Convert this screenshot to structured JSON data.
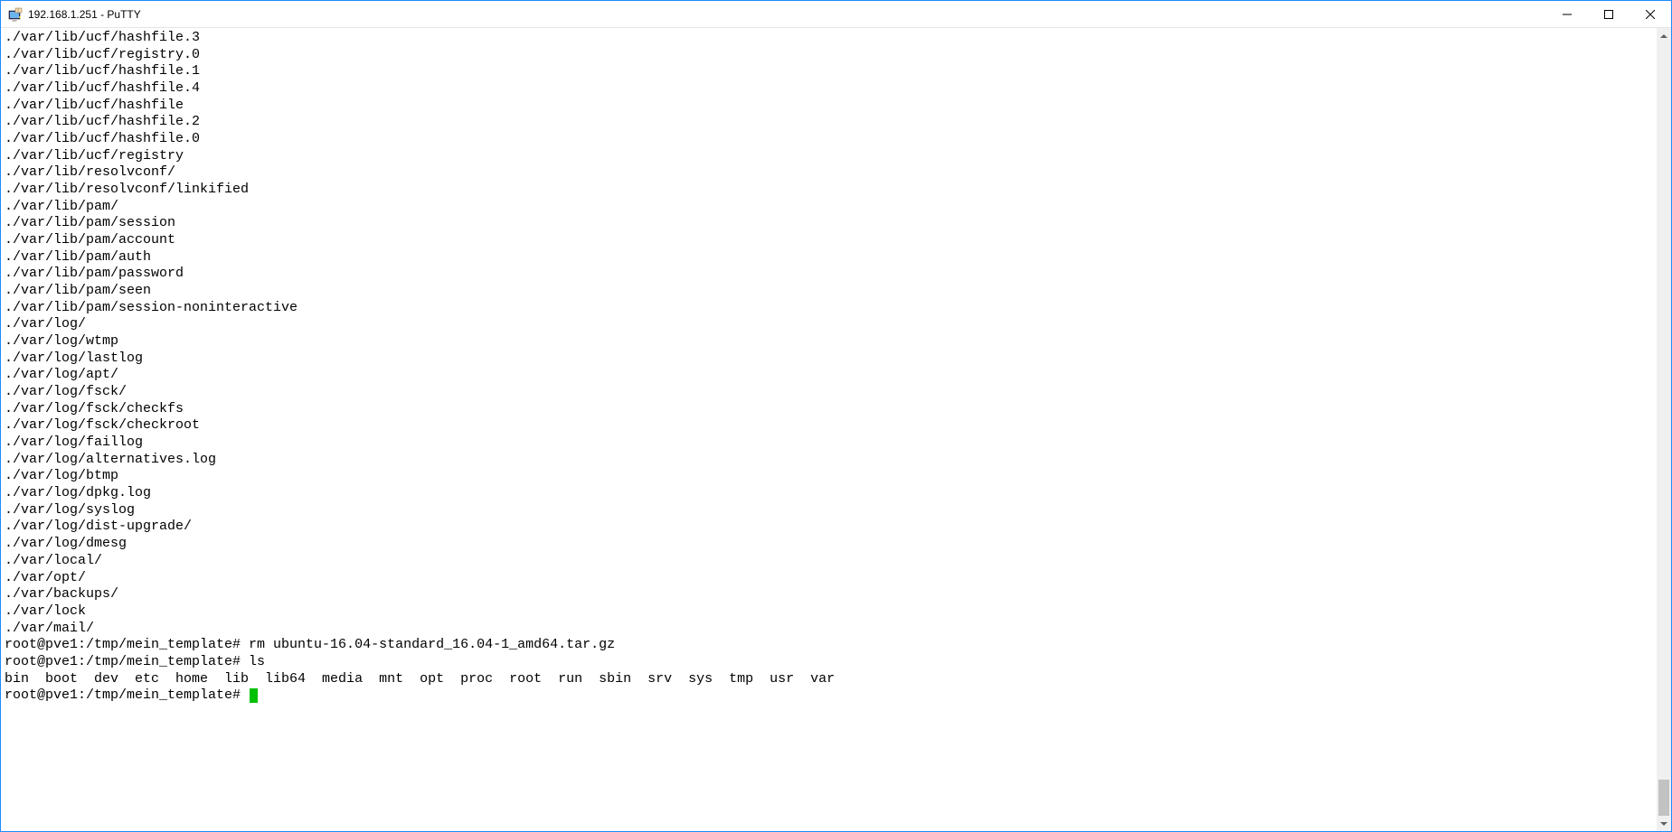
{
  "window": {
    "title": "192.168.1.251 - PuTTY"
  },
  "terminal": {
    "output_lines": [
      "./var/lib/ucf/hashfile.3",
      "./var/lib/ucf/registry.0",
      "./var/lib/ucf/hashfile.1",
      "./var/lib/ucf/hashfile.4",
      "./var/lib/ucf/hashfile",
      "./var/lib/ucf/hashfile.2",
      "./var/lib/ucf/hashfile.0",
      "./var/lib/ucf/registry",
      "./var/lib/resolvconf/",
      "./var/lib/resolvconf/linkified",
      "./var/lib/pam/",
      "./var/lib/pam/session",
      "./var/lib/pam/account",
      "./var/lib/pam/auth",
      "./var/lib/pam/password",
      "./var/lib/pam/seen",
      "./var/lib/pam/session-noninteractive",
      "./var/log/",
      "./var/log/wtmp",
      "./var/log/lastlog",
      "./var/log/apt/",
      "./var/log/fsck/",
      "./var/log/fsck/checkfs",
      "./var/log/fsck/checkroot",
      "./var/log/faillog",
      "./var/log/alternatives.log",
      "./var/log/btmp",
      "./var/log/dpkg.log",
      "./var/log/syslog",
      "./var/log/dist-upgrade/",
      "./var/log/dmesg",
      "./var/local/",
      "./var/opt/",
      "./var/backups/",
      "./var/lock",
      "./var/mail/"
    ],
    "prompt1": {
      "prompt": "root@pve1:/tmp/mein_template#",
      "command": "rm ubuntu-16.04-standard_16.04-1_amd64.tar.gz"
    },
    "prompt2": {
      "prompt": "root@pve1:/tmp/mein_template#",
      "command": "ls"
    },
    "ls_output": "bin  boot  dev  etc  home  lib  lib64  media  mnt  opt  proc  root  run  sbin  srv  sys  tmp  usr  var",
    "prompt3": {
      "prompt": "root@pve1:/tmp/mein_template#",
      "command": ""
    }
  }
}
